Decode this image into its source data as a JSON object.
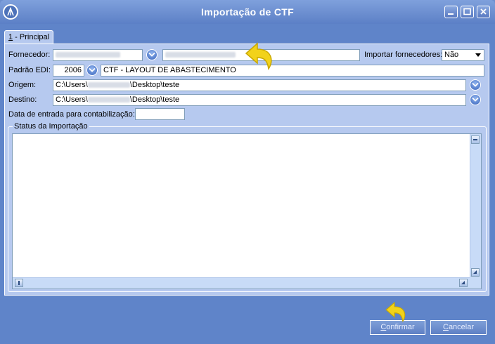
{
  "window": {
    "title": "Importação de CTF"
  },
  "tabs": [
    {
      "label": "1 - Principal",
      "shortcut": "1",
      "rest": " - Principal"
    }
  ],
  "form": {
    "fornecedor_label": "Fornecedor:",
    "importar_label": "Importar fornecedores:",
    "importar_value": "Não",
    "padrao_label": "Padrão EDI:",
    "padrao_code": "2006",
    "padrao_desc": "CTF - LAYOUT DE ABASTECIMENTO",
    "origem_label": "Origem:",
    "origem_prefix": "C:\\Users\\",
    "origem_suffix": "\\Desktop\\teste",
    "destino_label": "Destino:",
    "destino_prefix": "C:\\Users\\",
    "destino_suffix": "\\Desktop\\teste",
    "data_label": "Data de entrada para contabilização:",
    "data_value": ""
  },
  "status": {
    "title": "Status da Importação",
    "text": ""
  },
  "buttons": {
    "confirm": {
      "shortcut": "C",
      "rest": "onfirmar"
    },
    "cancel": {
      "shortcut": "C",
      "rest": "ancelar"
    }
  },
  "icons": [
    "app-logo-icon",
    "minimize-icon",
    "maximize-icon",
    "close-icon",
    "chevron-down-icon",
    "pointer-arrow-icon"
  ],
  "colors": {
    "window_bg": "#5f84c9",
    "panel_bg": "#b6c9ef",
    "pointer": "#f2d21a"
  }
}
